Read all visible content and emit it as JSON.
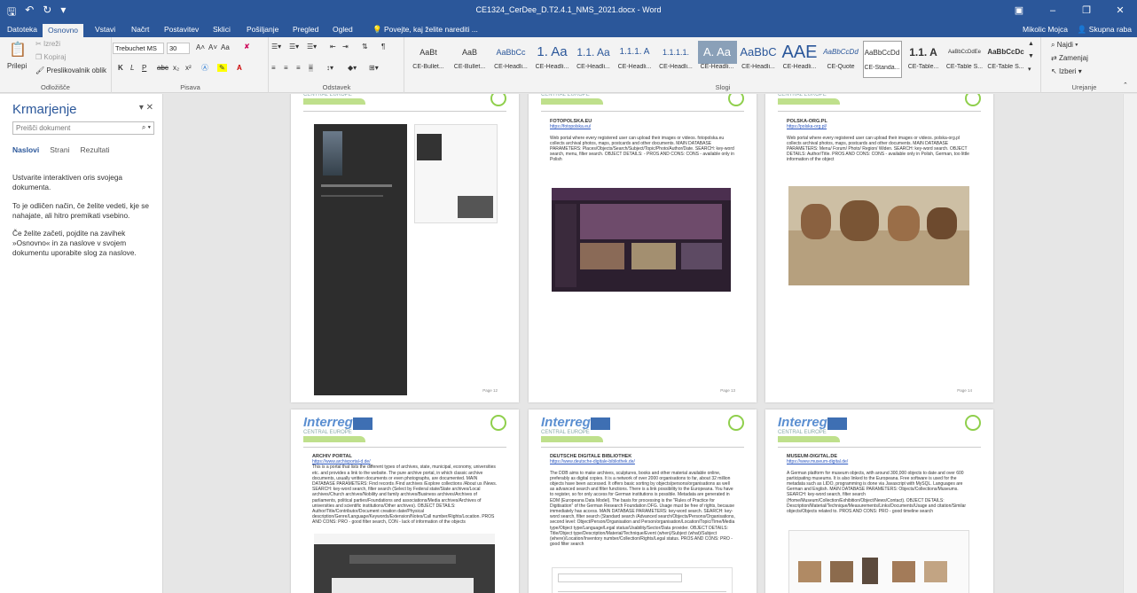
{
  "app": {
    "title": "CE1324_CerDee_D.T2.4.1_NMS_2021.docx - Word",
    "quick_access": [
      "save-icon",
      "undo-icon",
      "redo-icon",
      "customize-icon"
    ]
  },
  "tabs": [
    "Datoteka",
    "Osnovno",
    "Vstavi",
    "Načrt",
    "Postavitev",
    "Sklici",
    "Pošiljanje",
    "Pregled",
    "Ogled"
  ],
  "tell_me": "Povejte, kaj želite narediti ...",
  "user": "Mikolic Mojca",
  "share": "Skupna raba",
  "clipboard": {
    "paste": "Prilepi",
    "cut": "Izreži",
    "copy": "Kopiraj",
    "painter": "Preslikovalnik oblik",
    "label": "Odložišče"
  },
  "font": {
    "name": "Trebuchet MS",
    "size": "30",
    "label": "Pisava",
    "aa": "Aa",
    "bold": "K",
    "italic": "L",
    "underline": "P",
    "strike": "abc",
    "sub": "x₂",
    "sup": "x²"
  },
  "paragraph": {
    "label": "Odstavek"
  },
  "styles": {
    "label": "Slogi",
    "items": [
      {
        "preview": "AaBt",
        "name": "CE-Bullet..."
      },
      {
        "preview": "AaB",
        "name": "CE-Bullet..."
      },
      {
        "preview": "AaBbCc",
        "name": "CE-Headli..."
      },
      {
        "preview": "1. Aa",
        "name": "CE-Headli..."
      },
      {
        "preview": "1.1. Aa",
        "name": "CE-Headli..."
      },
      {
        "preview": "1.1.1. A",
        "name": "CE-Headli..."
      },
      {
        "preview": "1.1.1.1.",
        "name": "CE-Headli..."
      },
      {
        "preview": "A. Aa",
        "name": "CE-Headli..."
      },
      {
        "preview": "AaBbC",
        "name": "CE-Headli..."
      },
      {
        "preview": "AAE",
        "name": "CE-Headli..."
      },
      {
        "preview": "AaBbCcDd",
        "name": "CE-Quote"
      },
      {
        "preview": "AaBbCcDd",
        "name": "CE-Standa..."
      },
      {
        "preview": "1.1. A",
        "name": "CE-Table..."
      },
      {
        "preview": "AaBbCcDdEe",
        "name": "CE-Table S..."
      },
      {
        "preview": "AaBbCcDc",
        "name": "CE-Table S..."
      }
    ]
  },
  "editing": {
    "find": "Najdi",
    "replace": "Zamenjaj",
    "select": "Izberi",
    "label": "Urejanje"
  },
  "nav": {
    "title": "Krmarjenje",
    "search_placeholder": "Preišči dokument",
    "tabs": [
      "Naslovi",
      "Strani",
      "Rezultati"
    ],
    "msg1": "Ustvarite interaktiven oris svojega dokumenta.",
    "msg2": "To je odličen način, če želite vedeti, kje se nahajate, ali hitro premikati vsebino.",
    "msg3": "Če želite začeti, pojdite na zavihek »Osnovno« in za naslove v svojem dokumentu uporabite slog za naslove."
  },
  "pages": {
    "logo_text": "Interreg",
    "logo_sub": "CENTRAL EUROPE",
    "logo_proj": "CerDee",
    "p2": {
      "title": "FOTOPOLSKA.EU",
      "url": "https://fotopolska.eu/",
      "body": "Web portal where every registered user can upload their images or videos. fotopolska.eu collects archival photos, maps, postcards and other documents. MAIN DATABASE PARAMETERS: Places/Objects/Search/Subject/Topic/Photo/Author/Date. SEARCH: key-word search, menu, filter search. OBJECT DETAILS: - PROS AND CONS: CONS - available only in Polish"
    },
    "p3": {
      "title": "POLSKA-ORG.PL",
      "url": "https://polska-org.pl/",
      "body": "Web portal where every registered user can upload their images or videos. polska-org.pl collects archival photos, maps, postcards and other documents. MAIN DATABASE PARAMETERS: Menu/ Forum/ Photo/ Region/ Widen. SEARCH: key-word search. OBJECT DETAILS: Author/Title. PROS AND CONS: CONS - available only in Polish, German, too little information of the object"
    },
    "p4": {
      "title": "ARCHIV PORTAL",
      "url": "https://www.archivportal-d.de/",
      "body": "This is a portal that lists the different types of archives, state, municipal, economy, universities etc. and provides a link to the website. The pure archive portal, in which classic archive documents, usually written documents or even photographs, are documented. MAIN DATABASE PARAMETERS: Find records /Find archives /Explore collections /About us /News. SEARCH: key-word search, filter search (Select by Federal state/State archives/Local archives/Church archives/Nobility and family archives/Business archives/Archives of parliaments, political parties/Foundations and associations/Media archives/Archives of universities and scientific institutions/Other archives). OBJECT DETAILS: Author/Title/Contributor/Document creation date/Physical description/Genre/Language/Keywords/Extension/Notes/Call number/Rights/Location. PROS AND CONS: PRO - good filter search, CON - lack of information of the objects"
    },
    "p5": {
      "title": "DEUTSCHE DIGITALE BIBLIOTHEK",
      "url": "https://www.deutsche-digitale-bibliothek.de/",
      "body": "The DDB aims to make archives, sculptures, books and other material available online, preferably as digital copies. It is a network of over 2000 organisations to far, about 32 million objects have been accessed. It offers basic sorting by objects/persons/organisations as well as advanced search and filter functions. There is a link possibility to the Europeana. You have to register, so for only access for German institutions is possible. Metadata are generated in EDM (Europeana Data Model). The basis for processing is the \"Rules of Practice for Digitisation\" of the German Research Foundation DFG. Usage must be free of rights, because immediately has access. MAIN DATABASE PARAMETERS: key-word search. SEARCH: key-word search, filter search (Standard search /Advanced search/Objects/Persons/Organisations, second level: Object/Person/Organisation and Person/organisation/Location/Topic/Time/Media type/Object type/Language/Legal status/Usability/Sector/Data provider. OBJECT DETAILS: Title/Object type/Description/Material/Technique/Event (when)/Subject (what)/Subject (where)/Location/Inventory number/Collection/Rights/Legal status. PROS AND CONS: PRO - good filter search"
    },
    "p6": {
      "title": "MUSEUM-DIGITAL.DE",
      "url": "https://www.museum-digital.de/",
      "body": "A German platform for museum objects, with around 300,000 objects to date and over 600 participating museums. It is also linked to the Europeana. Free software is used for the metadata such as LIDO, programming is done via Javascript with MySQL. Languages are German and English. MAIN DATABASE PARAMETERS: Objects/Collections/Museums. SEARCH: key-word search, filter search (Home/Museum/Collection/Exhibition/Object/News/Contact). OBJECT DETAILS: Description/Material/Technique/Measurements/Links/Documents/Usage and citation/Similar objects/Objects related to. PROS AND CONS: PRO - good timeline search"
    },
    "page_no_a": "Page 12",
    "page_no_b": "Page 13",
    "page_no_c": "Page 14"
  }
}
